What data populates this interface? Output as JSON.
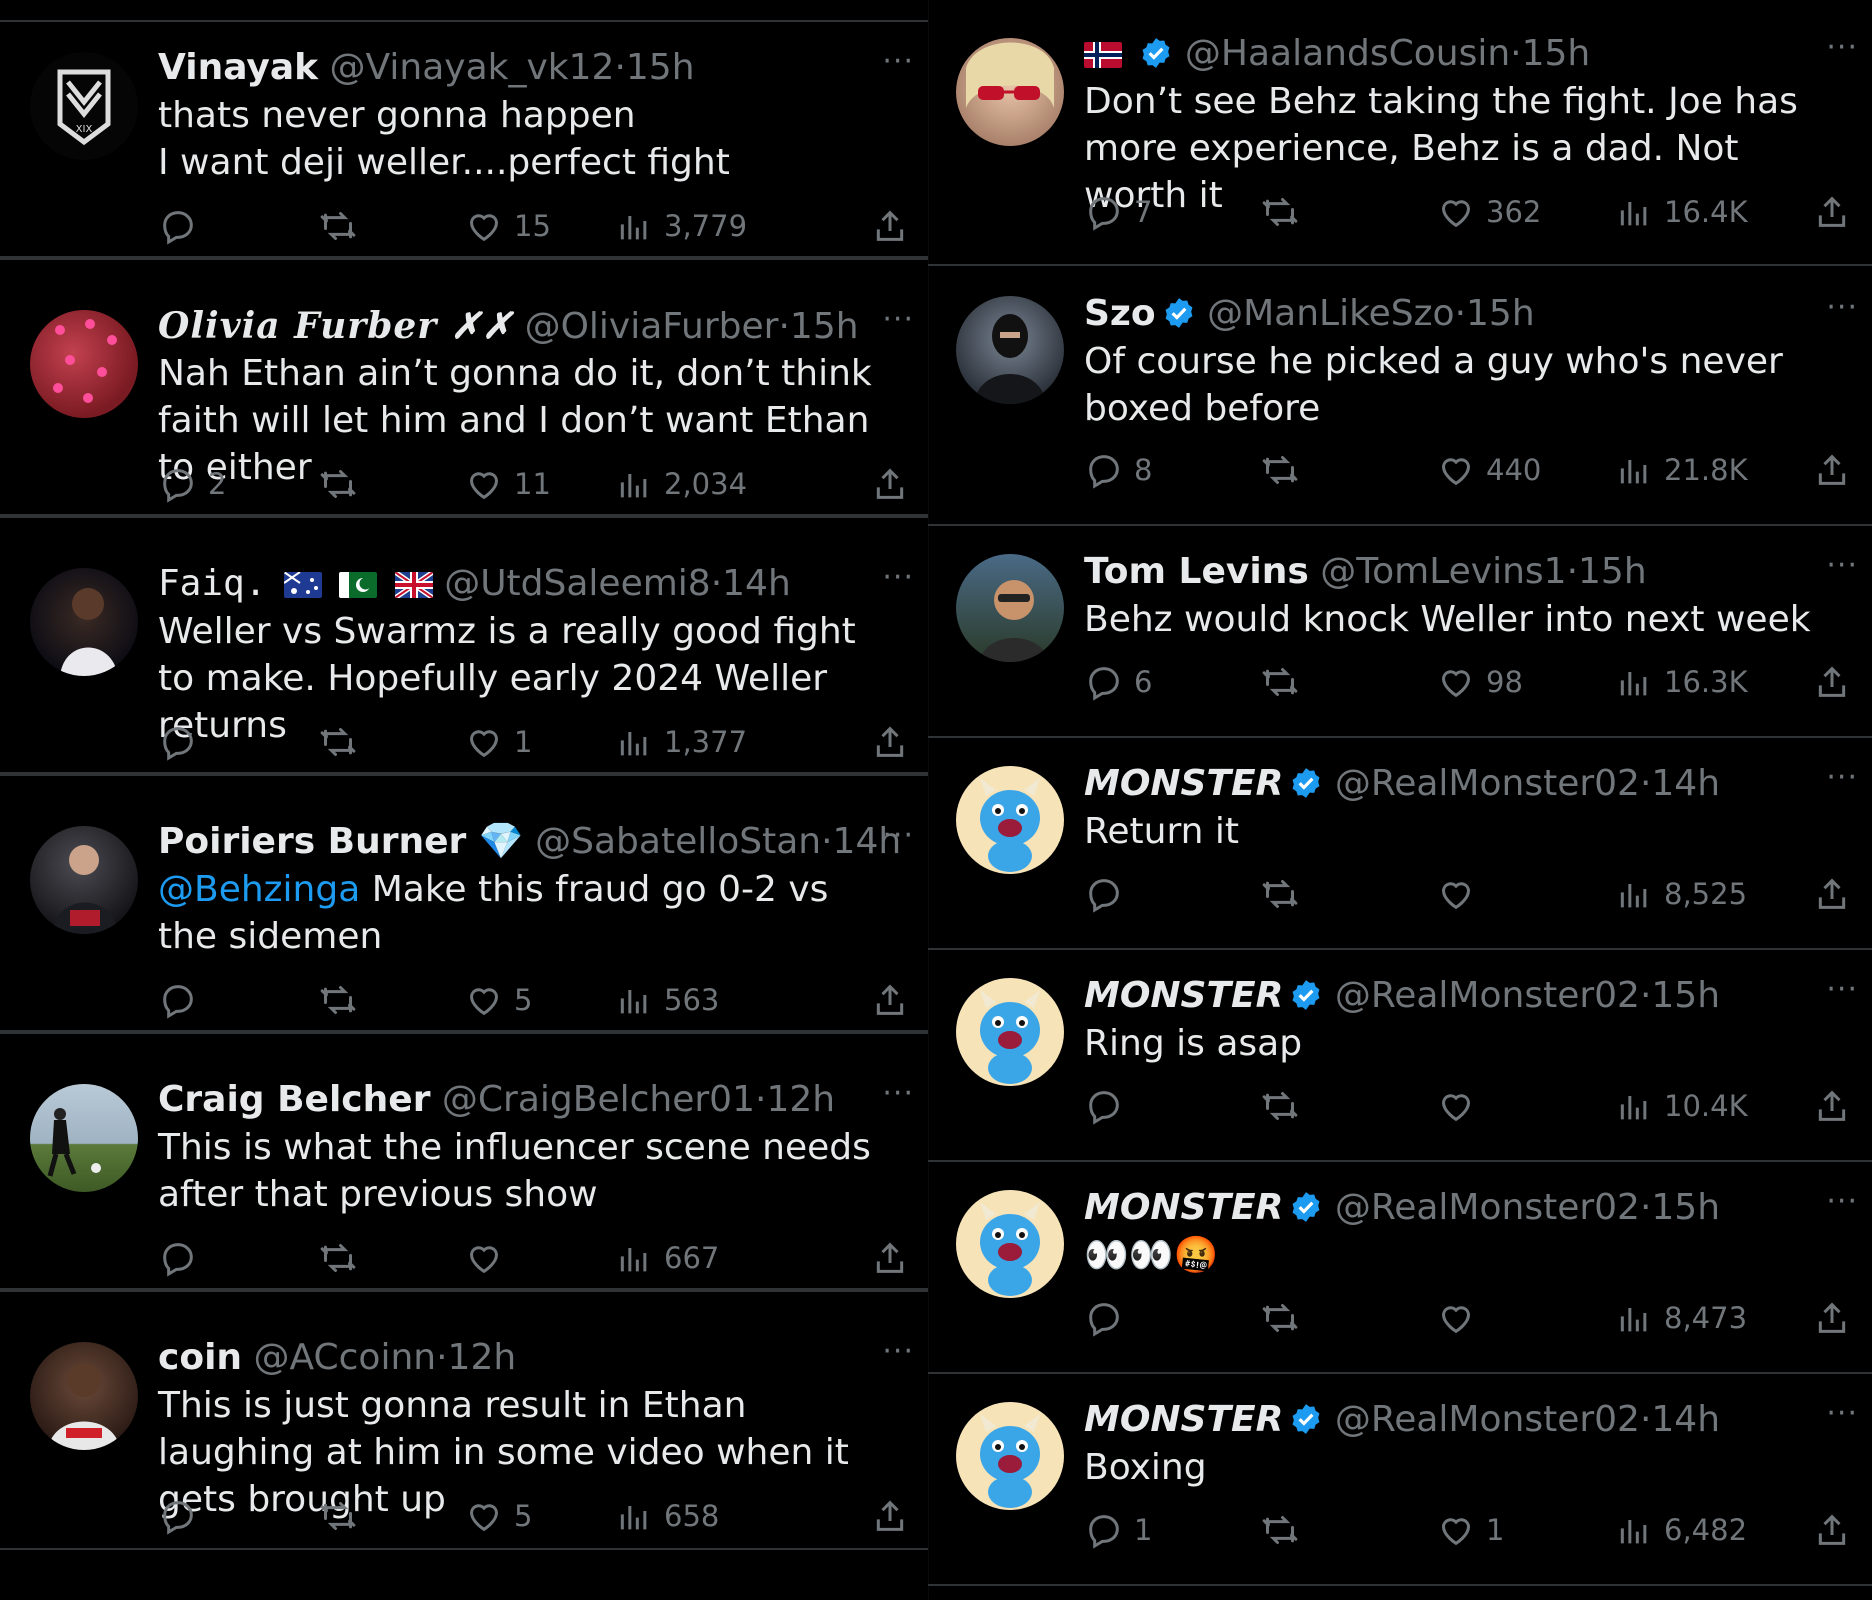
{
  "left_tweets": [
    {
      "name": "Vinayak",
      "handle": "@Vinayak_vk12",
      "time": "15h",
      "text": "thats never gonna happen\nI want deji weller....perfect fight",
      "replies": "",
      "likes": "15",
      "views": "3,779"
    },
    {
      "name": "Olivia Furber ✗✗",
      "handle": "@OliviaFurber",
      "time": "15h",
      "text": "Nah Ethan ain’t gonna do it, don’t think faith will let him and I don’t want Ethan to either",
      "replies": "2",
      "likes": "11",
      "views": "2,034"
    },
    {
      "name": "Faiq.",
      "handle": "@UtdSaleemi8",
      "time": "14h",
      "text": "Weller vs Swarmz is a really good fight to make. Hopefully early 2024 Weller returns",
      "replies": "",
      "likes": "1",
      "views": "1,377"
    },
    {
      "name": "Poiriers Burner 💎",
      "handle": "@SabatelloStan",
      "time": "14h",
      "mention": "@Behzinga",
      "text": " Make this fraud go 0-2 vs the sidemen",
      "replies": "",
      "likes": "5",
      "views": "563"
    },
    {
      "name": "Craig Belcher",
      "handle": "@CraigBelcher01",
      "time": "12h",
      "text": "This is what the influencer scene needs after that previous show",
      "replies": "",
      "likes": "",
      "views": "667"
    },
    {
      "name": "coin",
      "handle": "@ACcoinn",
      "time": "12h",
      "text": "This is just gonna result in Ethan laughing at him in some video when it gets brought up",
      "replies": "",
      "likes": "5",
      "views": "658"
    }
  ],
  "right_tweets": [
    {
      "name": "",
      "handle": "@HaalandsCousin",
      "time": "15h",
      "text": "Don’t see Behz taking the fight. Joe has more experience, Behz is a dad. Not worth it",
      "replies": "7",
      "likes": "362",
      "views": "16.4K"
    },
    {
      "name": "Szo",
      "handle": "@ManLikeSzo",
      "time": "15h",
      "text": "Of course he picked a guy who's never boxed before",
      "replies": "8",
      "likes": "440",
      "views": "21.8K"
    },
    {
      "name": "Tom Levins",
      "handle": "@TomLevins1",
      "time": "15h",
      "text": "Behz would knock Weller into next week",
      "replies": "6",
      "likes": "98",
      "views": "16.3K"
    },
    {
      "name": "MONSTER",
      "handle": "@RealMonster02",
      "time": "14h",
      "text": "Return it",
      "replies": "",
      "likes": "",
      "views": "8,525"
    },
    {
      "name": "MONSTER",
      "handle": "@RealMonster02",
      "time": "15h",
      "text": "Ring is asap",
      "replies": "",
      "likes": "",
      "views": "10.4K"
    },
    {
      "name": "MONSTER",
      "handle": "@RealMonster02",
      "time": "15h",
      "text": "👀👀🤬",
      "replies": "",
      "likes": "",
      "views": "8,473"
    },
    {
      "name": "MONSTER",
      "handle": "@RealMonster02",
      "time": "14h",
      "text": "Boxing",
      "replies": "1",
      "likes": "1",
      "views": "6,482"
    }
  ],
  "more_label": "···",
  "dot": "·",
  "colors": {
    "background": "#000000",
    "text": "#e7e9ea",
    "muted": "#71767b",
    "link": "#1d9bf0",
    "divider": "#2f3336"
  }
}
